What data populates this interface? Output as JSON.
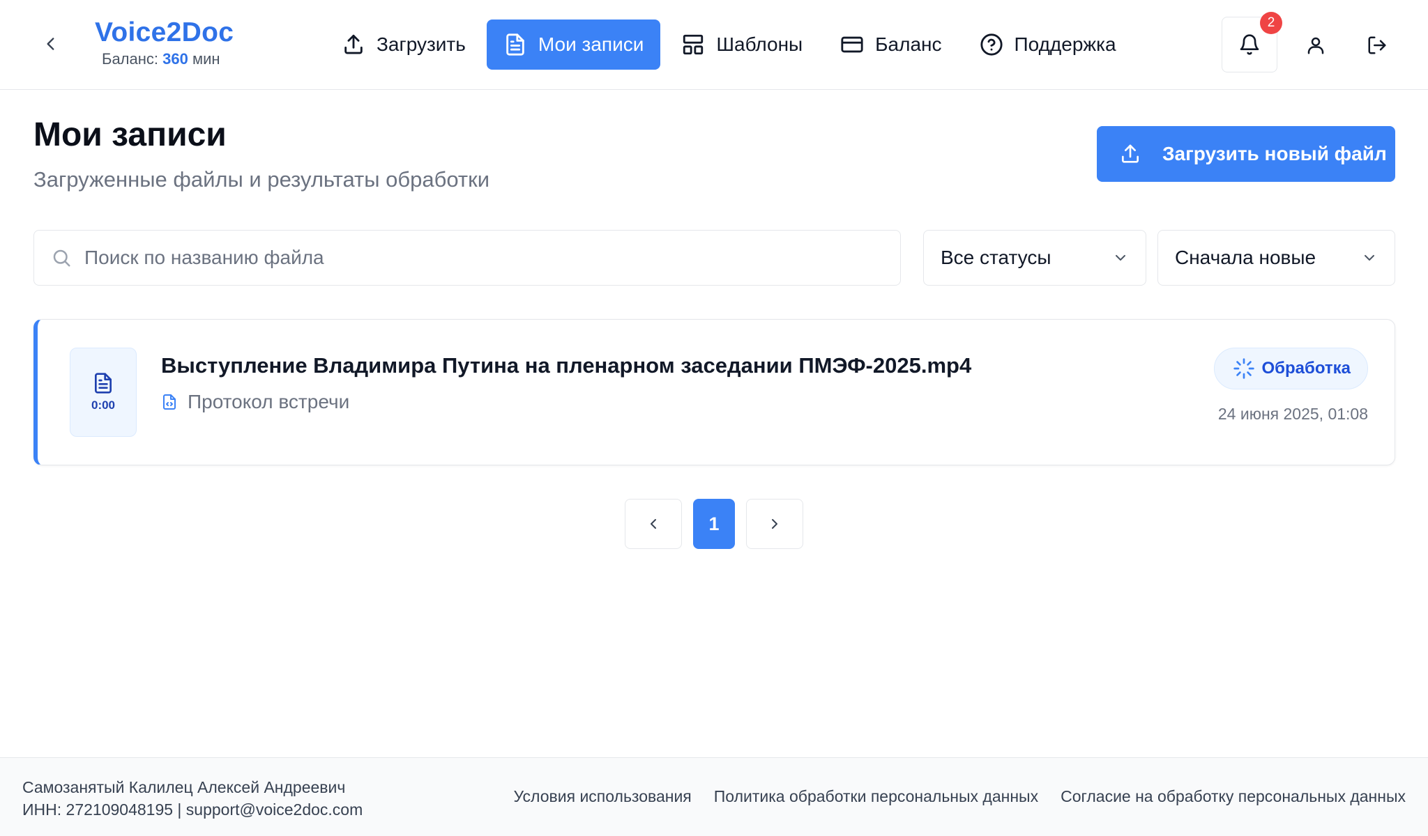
{
  "header": {
    "brand": "Voice2Doc",
    "balance_label": "Баланс:",
    "balance_value": "360",
    "balance_unit": "мин",
    "nav": [
      {
        "label": "Загрузить",
        "icon": "upload-icon"
      },
      {
        "label": "Мои записи",
        "icon": "document-icon",
        "active": true
      },
      {
        "label": "Шаблоны",
        "icon": "layout-icon"
      },
      {
        "label": "Баланс",
        "icon": "credit-card-icon"
      },
      {
        "label": "Поддержка",
        "icon": "help-circle-icon"
      }
    ],
    "notifications_count": "2"
  },
  "page": {
    "title": "Мои записи",
    "subtitle": "Загруженные файлы и результаты обработки",
    "upload_button": "Загрузить новый файл"
  },
  "filters": {
    "search_placeholder": "Поиск по названию файла",
    "status_selected": "Все статусы",
    "sort_selected": "Сначала новые"
  },
  "records": [
    {
      "duration": "0:00",
      "title": "Выступление Владимира Путина на пленарном заседании ПМЭФ-2025.mp4",
      "template": "Протокол встречи",
      "status": "Обработка",
      "date": "24 июня 2025, 01:08"
    }
  ],
  "pagination": {
    "current": "1"
  },
  "footer": {
    "owner": "Самозанятый Калилец Алексей Андреевич",
    "contacts": "ИНН: 272109048195 | support@voice2doc.com",
    "links": [
      "Условия использования",
      "Политика обработки персональных данных",
      "Согласие на обработку персональных данных"
    ]
  },
  "colors": {
    "accent": "#3b82f6",
    "brand": "#2f72e8",
    "badge": "#ef4444"
  }
}
